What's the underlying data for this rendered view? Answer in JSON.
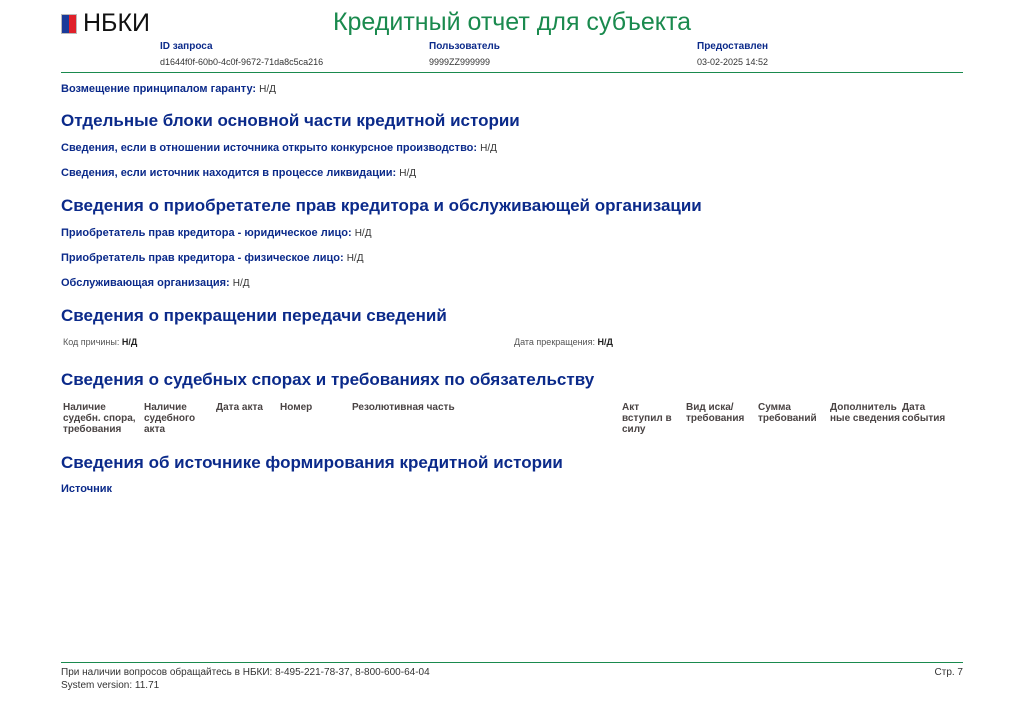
{
  "header": {
    "logo": "НБКИ",
    "logo_colors": [
      "#1a3a9a",
      "#e0202a"
    ],
    "title": "Кредитный отчет для субъекта",
    "request_id_label": "ID запроса",
    "request_id": "d1644f0f-60b0-4c0f-9672-71da8c5ca216",
    "user_label": "Пользователь",
    "user": "9999ZZ999999",
    "provided_label": "Предоставлен",
    "provided": "03-02-2025 14:52"
  },
  "guarantor": {
    "label": "Возмещение принципалом гаранту:",
    "value": "Н/Д"
  },
  "sections": {
    "blocks": {
      "title": "Отдельные блоки основной части кредитной истории",
      "bankruptcy_label": "Сведения, если в отношении источника открыто конкурсное производство:",
      "bankruptcy": "Н/Д",
      "liquidation_label": "Сведения, если источник находится в процессе ликвидации:",
      "liquidation": "Н/Д"
    },
    "acquirer": {
      "title": "Сведения о приобретателе прав кредитора и обслуживающей организации",
      "legal_label": "Приобретатель прав кредитора - юридическое лицо:",
      "legal": "Н/Д",
      "person_label": "Приобретатель прав кредитора - физическое лицо:",
      "person": "Н/Д",
      "servicer_label": "Обслуживающая организация:",
      "servicer": "Н/Д"
    },
    "termination": {
      "title": "Сведения о прекращении передачи сведений",
      "reason_label": "Код причины:",
      "reason": "Н/Д",
      "date_label": "Дата прекращения:",
      "date": "Н/Д"
    },
    "court": {
      "title": "Сведения о судебных спорах и требованиях по обязательству",
      "columns": [
        "Наличие судебн. спора, требования",
        "Наличие судебного акта",
        "Дата акта",
        "Номер",
        "Резолютивная часть",
        "Акт вступил в силу",
        "Вид иска/ требования",
        "Сумма требований",
        "Дополнитель ные сведения",
        "Дата события"
      ]
    },
    "source": {
      "title": "Сведения об источнике формирования кредитной истории",
      "label": "Источник"
    }
  },
  "footer": {
    "contact": "При наличии вопросов обращайтесь в НБКИ: 8-495-221-78-37, 8-800-600-64-04",
    "version": "System version: 11.71",
    "page": "Стр. 7"
  }
}
